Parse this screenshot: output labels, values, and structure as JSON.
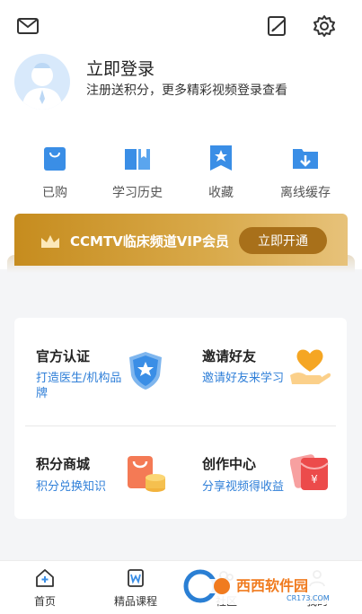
{
  "header": {
    "icons": [
      "mail-icon",
      "edit-icon",
      "gear-icon"
    ]
  },
  "profile": {
    "title": "立即登录",
    "subtitle": "注册送积分，更多精彩视频登录查看"
  },
  "quick_actions": [
    {
      "label": "已购",
      "icon": "shopping-bag-icon"
    },
    {
      "label": "学习历史",
      "icon": "book-icon"
    },
    {
      "label": "收藏",
      "icon": "star-bookmark-icon"
    },
    {
      "label": "离线缓存",
      "icon": "download-folder-icon"
    }
  ],
  "vip": {
    "text": "CCMTV临床频道VIP会员",
    "button": "立即开通",
    "icon": "crown-icon"
  },
  "services": [
    {
      "title": "官方认证",
      "subtitle": "打造医生/机构品牌",
      "icon": "shield-star-icon"
    },
    {
      "title": "邀请好友",
      "subtitle": "邀请好友来学习",
      "icon": "heart-hand-icon"
    },
    {
      "title": "积分商城",
      "subtitle": "积分兑换知识",
      "icon": "coin-bag-icon"
    },
    {
      "title": "创作中心",
      "subtitle": "分享视频得收益",
      "icon": "red-envelope-icon"
    }
  ],
  "tabbar": [
    {
      "label": "首页",
      "icon": "home-plus-icon"
    },
    {
      "label": "精品课程",
      "icon": "course-icon"
    },
    {
      "label": "社区",
      "icon": "community-icon"
    },
    {
      "label": "我的",
      "icon": "profile-icon"
    }
  ],
  "watermark": {
    "text": "西西软件园",
    "sub": "CR173.COM"
  },
  "colors": {
    "accent_blue": "#3a8ee6",
    "vip_gold": "#c68c1e",
    "link_blue": "#2f7fd8"
  }
}
